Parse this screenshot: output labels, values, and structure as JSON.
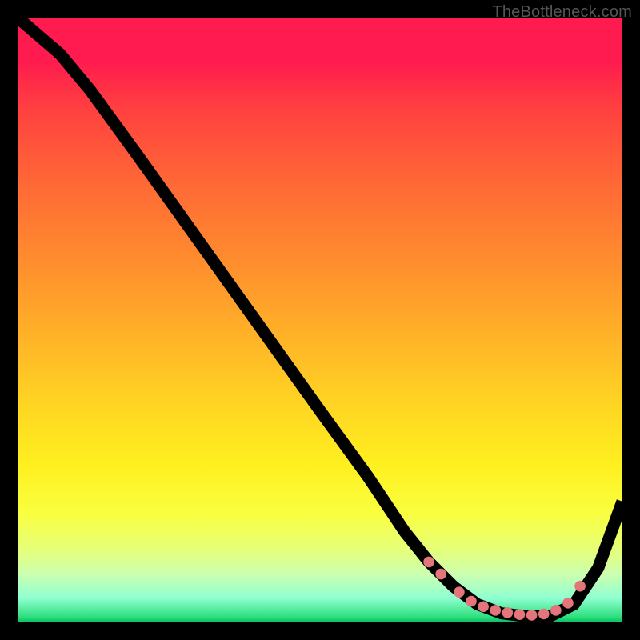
{
  "watermark": "TheBottleneck.com",
  "colors": {
    "page_bg": "#000000",
    "curve": "#000000",
    "dots": "#e4757a"
  },
  "chart_data": {
    "type": "line",
    "title": "",
    "xlabel": "",
    "ylabel": "",
    "xlim": [
      0,
      100
    ],
    "ylim": [
      0,
      100
    ],
    "grid": false,
    "legend": false,
    "series": [
      {
        "name": "bottleneck-curve",
        "x": [
          0,
          7,
          12,
          20,
          30,
          40,
          50,
          58,
          64,
          68,
          72,
          76,
          80,
          84,
          88,
          92,
          96,
          100
        ],
        "y": [
          100,
          94,
          88,
          77,
          63,
          49,
          35,
          24,
          15,
          10,
          6,
          3,
          1.5,
          1,
          1,
          3,
          9,
          20
        ]
      }
    ],
    "highlight_points": {
      "name": "optimal-range-dots",
      "x": [
        68,
        70,
        73,
        75,
        77,
        79,
        81,
        83,
        85,
        87,
        89,
        91,
        93
      ],
      "y": [
        10,
        8,
        5,
        3.5,
        2.6,
        2,
        1.6,
        1.3,
        1.2,
        1.4,
        2,
        3.2,
        6
      ]
    }
  }
}
